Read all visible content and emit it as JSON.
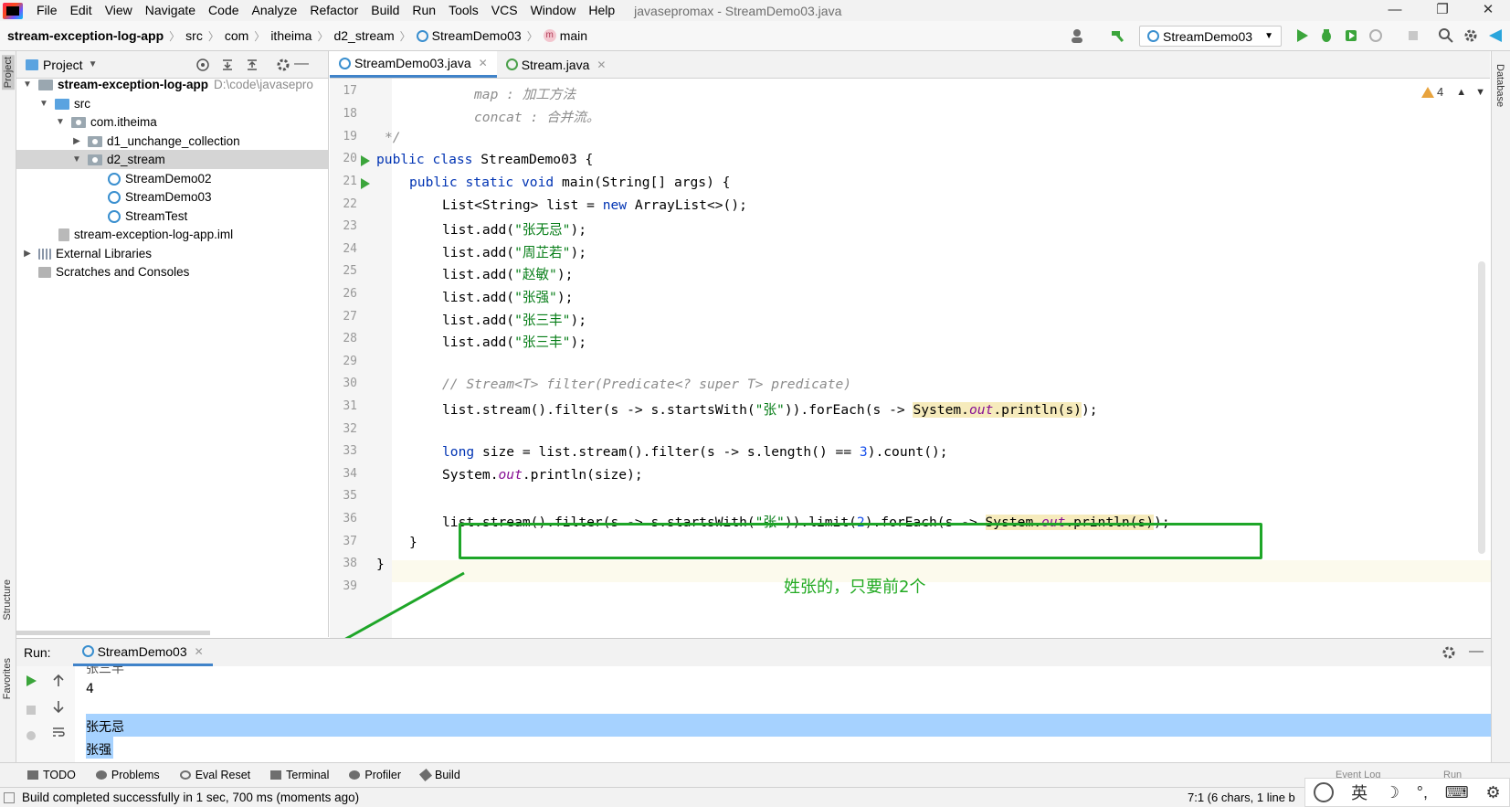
{
  "menu": {
    "items": [
      "File",
      "Edit",
      "View",
      "Navigate",
      "Code",
      "Analyze",
      "Refactor",
      "Build",
      "Run",
      "Tools",
      "VCS",
      "Window",
      "Help"
    ],
    "window_title": "javasepromax - StreamDemo03.java"
  },
  "window_controls": [
    "—",
    "❐",
    "✕"
  ],
  "breadcrumb": [
    "stream-exception-log-app",
    "src",
    "com",
    "itheima",
    "d2_stream",
    "StreamDemo03",
    "main"
  ],
  "toolbar": {
    "run_config": "StreamDemo03"
  },
  "project_panel": {
    "title": "Project",
    "root_name": "stream-exception-log-app",
    "root_path": "D:\\code\\javasepro",
    "src": "src",
    "package": "com.itheima",
    "folder1": "d1_unchange_collection",
    "folder2": "d2_stream",
    "files": [
      "StreamDemo02",
      "StreamDemo03",
      "StreamTest"
    ],
    "iml": "stream-exception-log-app.iml",
    "external": "External Libraries",
    "scratches": "Scratches and Consoles"
  },
  "editor": {
    "tabs": [
      "StreamDemo03.java",
      "Stream.java"
    ],
    "warnings": "4",
    "line_numbers": [
      "17",
      "18",
      "19",
      "20",
      "21",
      "22",
      "23",
      "24",
      "25",
      "26",
      "27",
      "28",
      "29",
      "30",
      "31",
      "32",
      "33",
      "34",
      "35",
      "36",
      "37",
      "38",
      "39"
    ],
    "lines": {
      "l17a": "map : ",
      "l17b": "加工方法",
      "l18a": "concat : ",
      "l18b": "合并流。",
      "l19": "*/",
      "l20kw": "public class ",
      "l20": "StreamDemo03 {",
      "l21kw": "public static void ",
      "l21": "main(String[] args) {",
      "l22a": "List<String> list = ",
      "l22kw": "new ",
      "l22b": "ArrayList<>();",
      "add": "list.add(",
      "s1": "\"张无忌\"",
      "s2": "\"周芷若\"",
      "s3": "\"赵敏\"",
      "s4": "\"张强\"",
      "s5": "\"张三丰\"",
      "s6": "\"张三丰\"",
      "end": ");",
      "l30": "// Stream<T> filter(Predicate<? super T> predicate)",
      "l31a": "list.stream().filter(s -> s.startsWith(",
      "l31s": "\"张\"",
      "l31b": ")).forEach(s -> ",
      "sysa": "System.",
      "sysout": "out",
      "sysb": ".println(s)",
      "l31end": ");",
      "l33kw": "long ",
      "l33a": "size = list.stream().filter(s -> s.length() == ",
      "l33n": "3",
      "l33b": ").count();",
      "l34a": "System.",
      "l34out": "out",
      "l34b": ".println(size);",
      "l36a": "list.stream().filter(s -> s.startsWith(",
      "l36s": "\"张\"",
      "l36b": ")).limit(",
      "l36n": "2",
      "l36c": ").forEach(s -> ",
      "l37": "}",
      "l38": "}"
    },
    "annotation": "姓张的，只要前2个"
  },
  "run_panel": {
    "label": "Run:",
    "tab": "StreamDemo03",
    "output": [
      "张三丰",
      "4",
      "张无忌",
      "张强"
    ]
  },
  "bottom_tools": [
    "TODO",
    "Problems",
    "Eval Reset",
    "Terminal",
    "Profiler",
    "Build"
  ],
  "right_tools": {
    "database": "Database",
    "event_log": "Event Log",
    "run": "Run"
  },
  "left_tools": {
    "project": "Project",
    "structure": "Structure",
    "favorites": "Favorites"
  },
  "status": {
    "message": "Build completed successfully in 1 sec, 700 ms (moments ago)",
    "position": "7:1 (6 chars, 1 line b"
  },
  "ime": {
    "lang": "英"
  }
}
